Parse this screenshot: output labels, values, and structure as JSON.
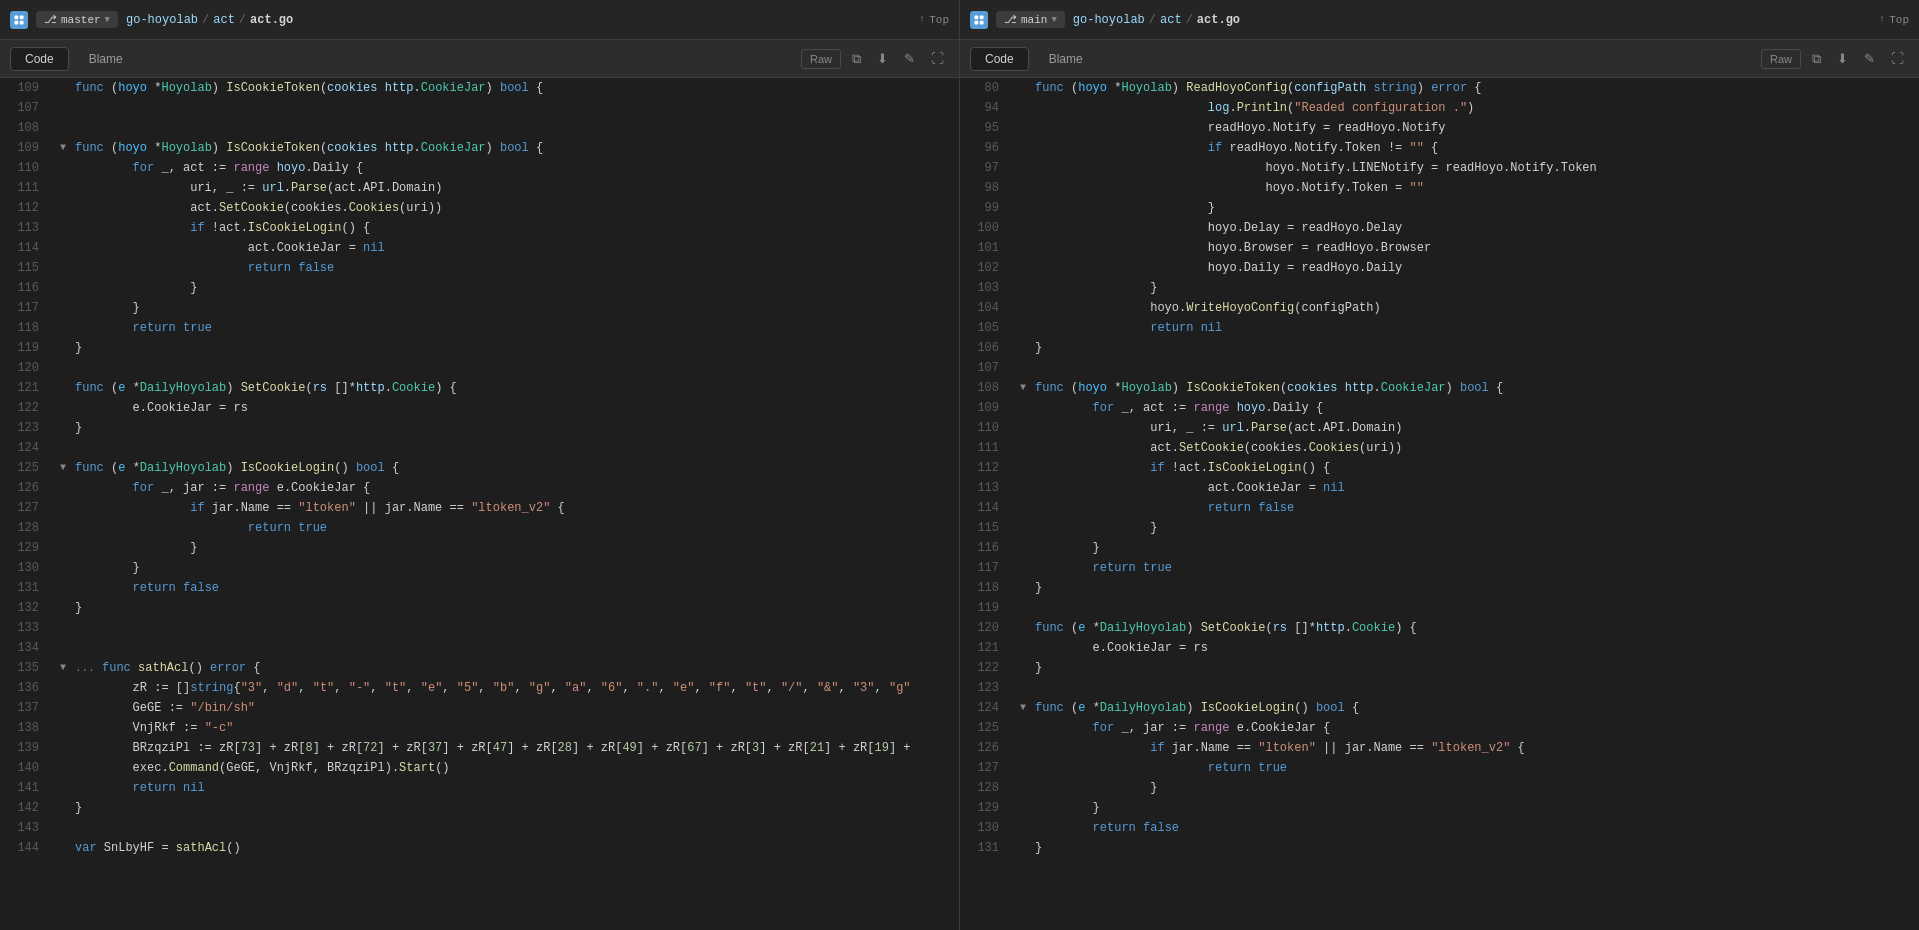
{
  "panes": [
    {
      "id": "left",
      "branch": "master",
      "breadcrumb": [
        "go-hoyolab",
        "act",
        "act.go"
      ],
      "top_label": "Top",
      "tabs": [
        "Code",
        "Blame"
      ],
      "active_tab": "Code",
      "toolbar_buttons": [
        "Raw",
        "copy",
        "download",
        "edit",
        "fullscreen"
      ]
    },
    {
      "id": "right",
      "branch": "main",
      "breadcrumb": [
        "go-hoyolab",
        "act",
        "act.go"
      ],
      "top_label": "Top",
      "tabs": [
        "Code",
        "Blame"
      ],
      "active_tab": "Code",
      "toolbar_buttons": [
        "Raw",
        "copy",
        "download",
        "edit",
        "fullscreen"
      ]
    }
  ]
}
